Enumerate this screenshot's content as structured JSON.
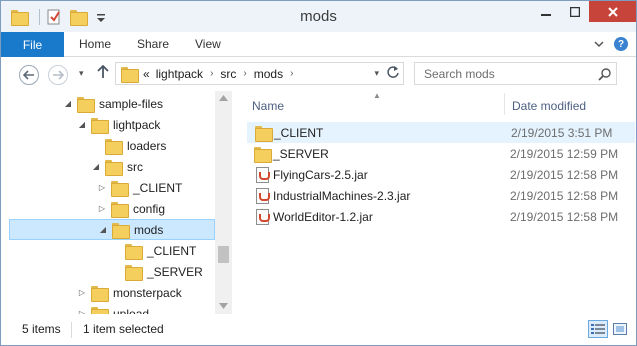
{
  "window": {
    "title": "mods"
  },
  "ribbon": {
    "file_label": "File",
    "tabs": [
      "Home",
      "Share",
      "View"
    ]
  },
  "address": {
    "overflow": "«",
    "crumbs": [
      "lightpack",
      "src",
      "mods"
    ]
  },
  "search": {
    "placeholder": "Search mods"
  },
  "tree": {
    "items": [
      {
        "label": "sample-files",
        "expander": "expanded",
        "depth": 2
      },
      {
        "label": "lightpack",
        "expander": "expanded",
        "depth": 3
      },
      {
        "label": "loaders",
        "expander": "none",
        "depth": 4
      },
      {
        "label": "src",
        "expander": "expanded",
        "depth": 4
      },
      {
        "label": "_CLIENT",
        "expander": "collapsed",
        "depth": 5
      },
      {
        "label": "config",
        "expander": "collapsed",
        "depth": 5
      },
      {
        "label": "mods",
        "expander": "expanded",
        "depth": 5,
        "selected": true
      },
      {
        "label": "_CLIENT",
        "expander": "none",
        "depth": 6
      },
      {
        "label": "_SERVER",
        "expander": "none",
        "depth": 6
      },
      {
        "label": "monsterpack",
        "expander": "collapsed",
        "depth": 3
      },
      {
        "label": "upload",
        "expander": "collapsed",
        "depth": 3
      }
    ]
  },
  "columns": {
    "name": "Name",
    "date_modified": "Date modified"
  },
  "files": [
    {
      "name": "_CLIENT",
      "date": "2/19/2015 3:51 PM",
      "icon": "folder-icon",
      "selected": true
    },
    {
      "name": "_SERVER",
      "date": "2/19/2015 12:59 PM",
      "icon": "folder-icon"
    },
    {
      "name": "FlyingCars-2.5.jar",
      "date": "2/19/2015 12:58 PM",
      "icon": "jar-file-icon"
    },
    {
      "name": "IndustrialMachines-2.3.jar",
      "date": "2/19/2015 12:58 PM",
      "icon": "jar-file-icon"
    },
    {
      "name": "WorldEditor-1.2.jar",
      "date": "2/19/2015 12:58 PM",
      "icon": "jar-file-icon"
    }
  ],
  "status": {
    "item_count": "5 items",
    "selection": "1 item selected"
  },
  "colors": {
    "accent": "#1979ca",
    "close_button": "#c7443b",
    "selection": "#cce8ff",
    "folder": "#f5cf5e"
  }
}
